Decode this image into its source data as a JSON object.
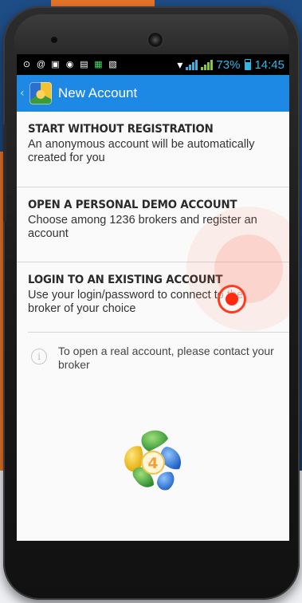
{
  "status_bar": {
    "battery": "73%",
    "time": "14:45"
  },
  "action_bar": {
    "title": "New Account"
  },
  "options": [
    {
      "title": "START WITHOUT REGISTRATION",
      "description": "An anonymous account will be automatically created for you"
    },
    {
      "title": "OPEN A PERSONAL DEMO ACCOUNT",
      "description": "Choose among 1236 brokers and register an account"
    },
    {
      "title": "LOGIN TO AN EXISTING ACCOUNT",
      "description": "Use your login/password to connect to the broker of your choice"
    }
  ],
  "info": {
    "text": "To open a real account, please contact your broker"
  },
  "logo": {
    "number": "4"
  },
  "colors": {
    "action_bar": "#1e88e5",
    "status_accent": "#33b5e5",
    "touch_indicator": "#ff3b1f"
  }
}
